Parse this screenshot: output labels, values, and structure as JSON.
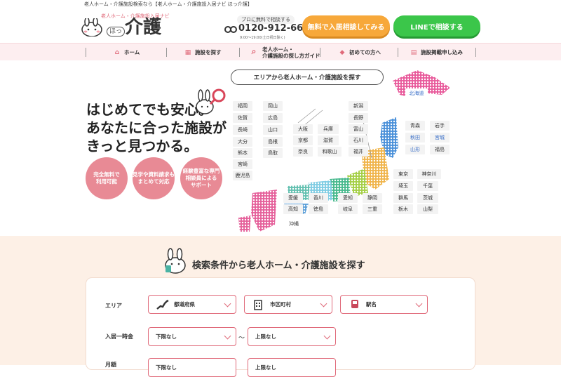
{
  "top_notice": "老人ホーム・介護施設検索なら【老人ホーム・介護施設入居ナビ ほっ介護】",
  "logo": {
    "sub": "老人ホーム・介護施設入居ナビ",
    "hot": "ほっ",
    "main": "介護"
  },
  "phone": {
    "label": "プロに無料で相談する",
    "number": "0120-912-667",
    "hours": "9:00～19:00(土日祝日除く)"
  },
  "cta": {
    "consult": "無料で入居相談してみる",
    "line": "LINEで相談する"
  },
  "nav": {
    "home": "ホーム",
    "search": "施設を探す",
    "guide_1": "老人ホーム・",
    "guide_2": "介護施設の探し方ガイド",
    "beginners": "初めての方へ",
    "apply": "施設掲載申し込み"
  },
  "hero": {
    "line1": "はじめてでも安心。",
    "line2": "あなたに合った施設が",
    "line3": "きっと見つかる。",
    "bubbles": [
      {
        "l1": "完全無料で",
        "l2": "利用可能"
      },
      {
        "l1": "見学や資料請求も",
        "l2": "まとめて対応"
      },
      {
        "l1": "経験豊富な専門",
        "l2": "相談員による",
        "l3": "サポート"
      }
    ]
  },
  "map": {
    "title": "エリアから老人ホーム・介護施設を探す",
    "prefs": {
      "fukuoka": "福岡",
      "saga": "佐賀",
      "nagasaki": "長崎",
      "oita": "大分",
      "kumamoto": "熊本",
      "miyazaki": "宮崎",
      "kagoshima": "鹿児島",
      "okayama": "岡山",
      "hiroshima": "広島",
      "yamaguchi": "山口",
      "shimane": "島根",
      "tottori": "鳥取",
      "osaka": "大阪",
      "hyogo": "兵庫",
      "kyoto": "京都",
      "shiga": "滋賀",
      "nara": "奈良",
      "wakayama": "和歌山",
      "niigata": "新潟",
      "nagano": "長野",
      "toyama": "富山",
      "ishikawa": "石川",
      "fukui": "福井",
      "hokkaido": "北海道",
      "aomori": "青森",
      "iwate": "岩手",
      "akita": "秋田",
      "miyagi": "宮城",
      "yamagata": "山形",
      "fukushima": "福島",
      "tokyo": "東京",
      "kanagawa": "神奈川",
      "saitama": "埼玉",
      "chiba": "千葉",
      "gunma": "群馬",
      "ibaraki": "茨城",
      "tochigi": "栃木",
      "yamanashi": "山梨",
      "ehime": "愛媛",
      "kagawa": "香川",
      "kochi": "高知",
      "tokushima": "徳島",
      "aichi": "愛知",
      "shizuoka": "静岡",
      "gifu": "岐阜",
      "mie": "三重",
      "okinawa": "沖縄"
    }
  },
  "search": {
    "title": "検索条件から老人ホーム・介護施設を探す",
    "area_label": "エリア",
    "pref_select": "都道府県",
    "city_select": "市区町村",
    "station_select": "駅名",
    "fee_label": "入居一時金",
    "fee_min": "下限なし",
    "tilde": "～",
    "fee_max": "上限なし",
    "row3_label": "月額",
    "row3_min": "下限なし",
    "row3_max": "上限なし"
  }
}
